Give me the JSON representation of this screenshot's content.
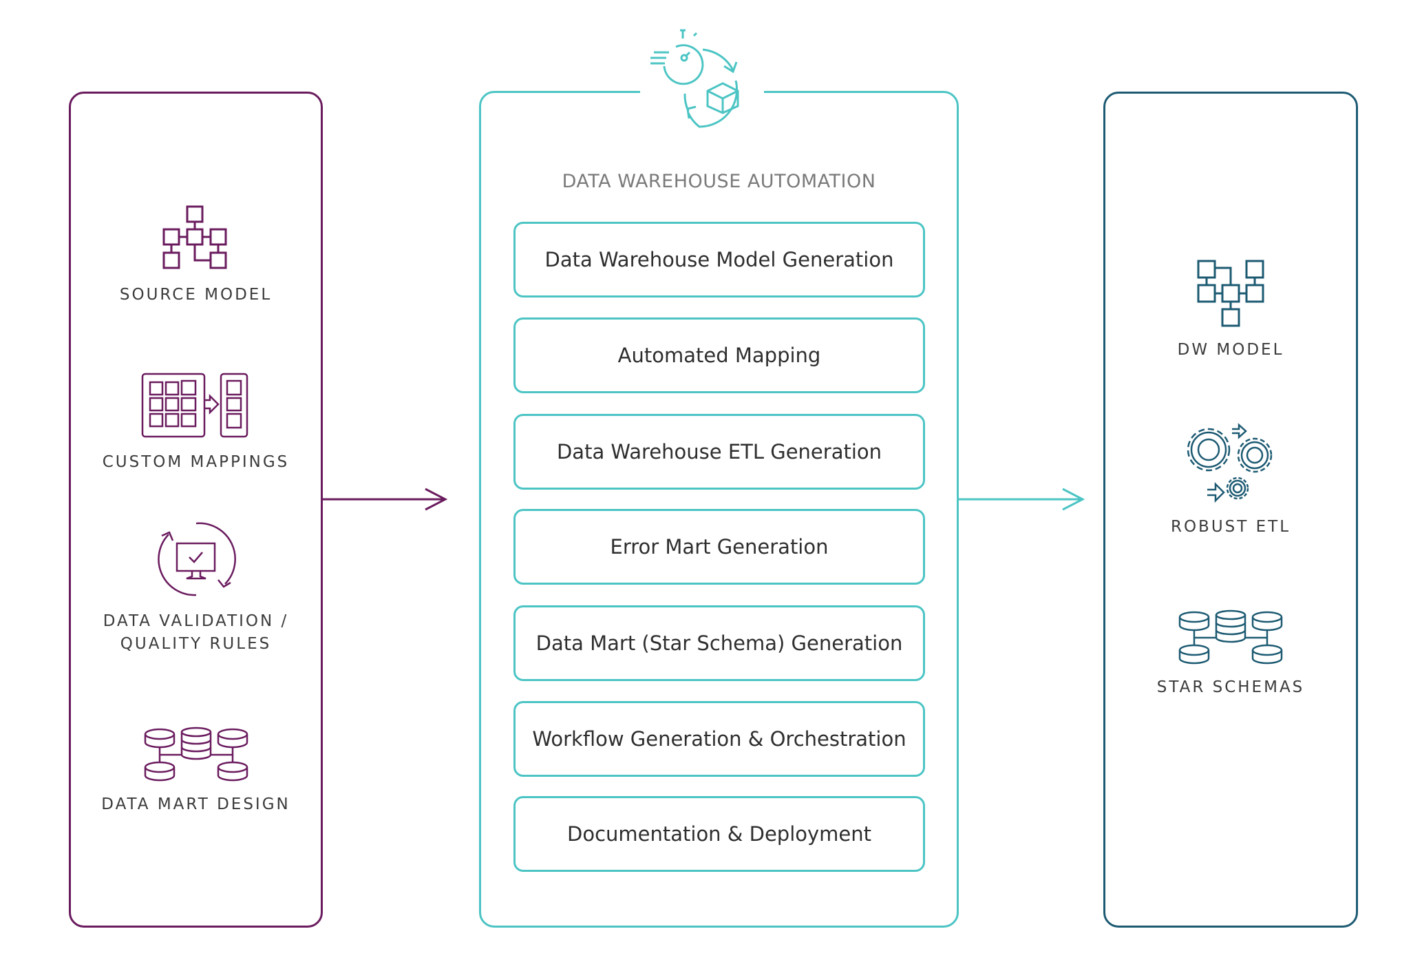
{
  "colors": {
    "input_purple": "#6a1b5e",
    "automation_teal": "#4cc4c4",
    "output_dark_teal": "#1c5a72",
    "label_text": "#3b3b3b",
    "title_gray": "#7a7a7a"
  },
  "inputs": {
    "items": [
      {
        "icon": "source-model-hierarchy-icon",
        "label": "SOURCE MODEL"
      },
      {
        "icon": "custom-mappings-grid-icon",
        "label": "CUSTOM MAPPINGS"
      },
      {
        "icon": "data-validation-monitor-icon",
        "label_line1": "DATA VALIDATION /",
        "label_line2": "QUALITY RULES"
      },
      {
        "icon": "data-mart-databases-icon",
        "label": "DATA MART DESIGN"
      }
    ]
  },
  "automation": {
    "icon": "automation-stopwatch-cycle-icon",
    "title": "DATA WAREHOUSE AUTOMATION",
    "steps": [
      "Data Warehouse Model Generation",
      "Automated Mapping",
      "Data Warehouse ETL Generation",
      "Error Mart Generation",
      "Data Mart (Star Schema) Generation",
      "Workflow Generation & Orchestration",
      "Documentation & Deployment"
    ]
  },
  "outputs": {
    "items": [
      {
        "icon": "dw-model-hierarchy-icon",
        "label": "DW MODEL"
      },
      {
        "icon": "robust-etl-gears-icon",
        "label": "ROBUST ETL"
      },
      {
        "icon": "star-schemas-databases-icon",
        "label": "STAR SCHEMAS"
      }
    ]
  }
}
